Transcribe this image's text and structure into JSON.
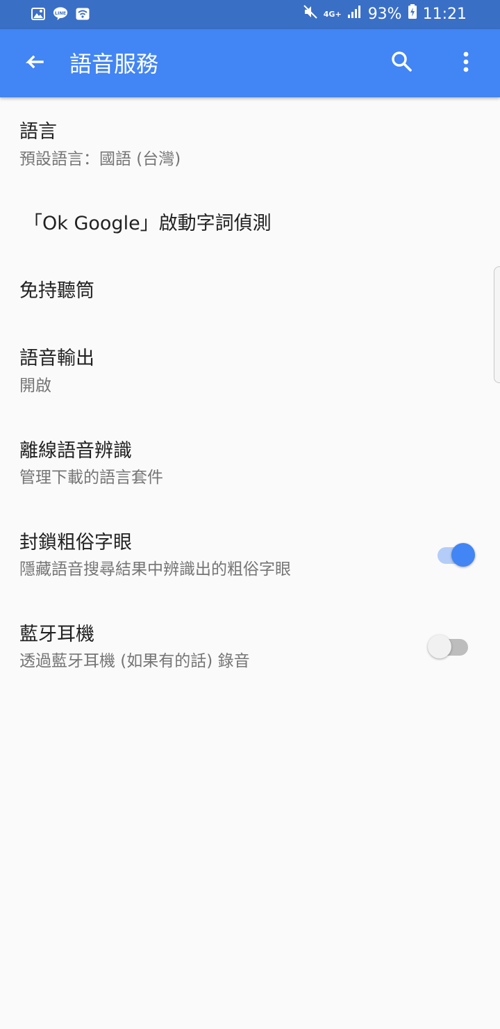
{
  "status_bar": {
    "battery": "93%",
    "time": "11:21",
    "network": "4G+",
    "icons": [
      "image-icon",
      "line-icon",
      "wifi-icon",
      "mute-icon",
      "signal-icon",
      "battery-charging-icon"
    ]
  },
  "app_bar": {
    "title": "語音服務",
    "icons": [
      "back-arrow-icon",
      "search-icon",
      "more-vert-icon"
    ]
  },
  "settings": {
    "language": {
      "title": "語言",
      "subtitle": "預設語言：國語 (台灣)"
    },
    "ok_google": {
      "title": "「Ok Google」啟動字詞偵測"
    },
    "handsfree": {
      "title": "免持聽筒"
    },
    "speech_output": {
      "title": "語音輸出",
      "subtitle": "開啟"
    },
    "offline": {
      "title": "離線語音辨識",
      "subtitle": "管理下載的語言套件"
    },
    "block_offensive": {
      "title": "封鎖粗俗字眼",
      "subtitle": "隱藏語音搜尋結果中辨識出的粗俗字眼",
      "enabled": true
    },
    "bluetooth": {
      "title": "藍牙耳機",
      "subtitle": "透過藍牙耳機 (如果有的話) 錄音",
      "enabled": false
    }
  },
  "colors": {
    "app_bar": "#4285f4",
    "status_bar": "#3a6fc6",
    "toggle_on_thumb": "#4285f4",
    "toggle_on_track": "#b3cdf8",
    "toggle_off_thumb": "#f1f1f1",
    "toggle_off_track": "#bdbdbd"
  }
}
